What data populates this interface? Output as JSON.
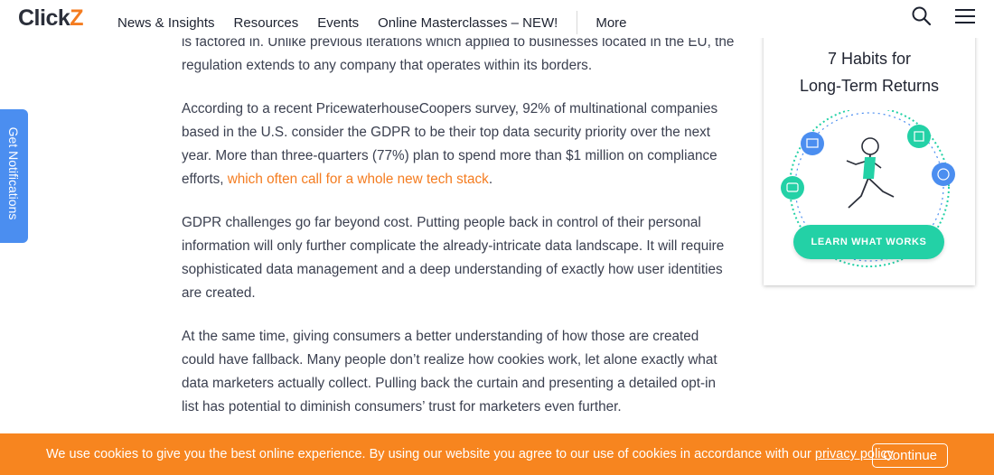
{
  "header": {
    "logo_text": "Click",
    "logo_accent": "Z",
    "nav": [
      "News & Insights",
      "Resources",
      "Events",
      "Online Masterclasses – NEW!"
    ],
    "more_label": "More",
    "icons": [
      "search-icon",
      "hamburger-menu-icon"
    ]
  },
  "notifications_tab": "Get Notifications",
  "article": {
    "p0": "is factored in. Unlike previous iterations which applied to businesses located in the EU, the regulation extends to any company that operates within its borders.",
    "p1_text": "According to a recent PricewaterhouseCoopers survey, 92% of multinational companies based in the U.S. consider the GDPR to be their top data security priority over the next year. More than three-quarters (77%) plan to spend more than $1 million on compliance efforts, ",
    "p1_link": "which often call for a whole new tech stack",
    "p1_end": ".",
    "p2": "GDPR challenges go far beyond cost. Putting people back in control of their personal information will only further complicate the already-intricate data landscape. It will require sophisticated data management and a deep understanding of exactly how user identities are created.",
    "p3": "At the same time, giving consumers a better understanding of how those are created could have fallback. Many people don’t realize how cookies work, let alone exactly what data marketers actually collect. Pulling back the curtain and presenting a detailed opt-in list has potential to diminish consumers’ trust for marketers even further."
  },
  "ad": {
    "title_line1": "7 Habits for",
    "title_line2": "Long-Term Returns",
    "cta": "LEARN WHAT WORKS"
  },
  "cookie": {
    "text": "We use cookies to give you the best online experience. By using our website you agree to our use of cookies in accordance with our ",
    "policy_link": "privacy policy",
    "button": "Continue"
  },
  "colors": {
    "brand_orange": "#f47c20",
    "notif_blue": "#4b8ef0",
    "cta_green": "#23d1a6"
  }
}
